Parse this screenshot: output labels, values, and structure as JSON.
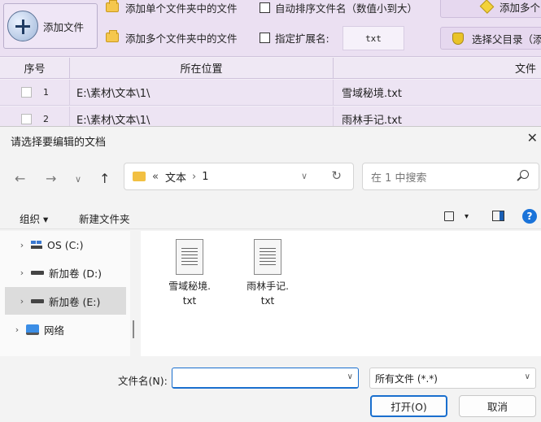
{
  "app": {
    "add_file_label": "添加文件",
    "add_single_folder_label": "添加单个文件夹中的文件",
    "add_multi_folder_label": "添加多个文件夹中的文件",
    "auto_sort_label": "自动排序文件名（数值小到大）",
    "ext_label": "指定扩展名:",
    "ext_value": "txt",
    "right_btn_1_label": "添加多个",
    "right_btn_2_label": "选择父目录（添"
  },
  "grid": {
    "headers": [
      "序号",
      "所在位置",
      "文件"
    ],
    "rows": [
      {
        "index": "1",
        "path": "E:\\素材\\文本\\1\\",
        "file": "雪域秘境.txt"
      },
      {
        "index": "2",
        "path": "E:\\素材\\文本\\1\\",
        "file": "雨林手记.txt"
      }
    ]
  },
  "dialog": {
    "title": "请选择要编辑的文档",
    "close_glyph": "✕",
    "nav": {
      "back": "←",
      "forward": "→",
      "recent": "∨",
      "up": "↑"
    },
    "breadcrumb": {
      "prefix": "«",
      "parts": [
        "文本",
        "1"
      ],
      "separator": "›",
      "dropdown": "∨",
      "refresh": "↻"
    },
    "search_placeholder": "在 1 中搜索",
    "commands": {
      "organize": "组织 ▾",
      "new_folder": "新建文件夹",
      "view_dropdown": "▾",
      "help": "?"
    },
    "tree": [
      {
        "arrow": "›",
        "label": "OS (C:)"
      },
      {
        "arrow": "›",
        "label": "新加卷 (D:)"
      },
      {
        "arrow": "›",
        "label": "新加卷 (E:)"
      },
      {
        "arrow": "›",
        "label": "网络"
      }
    ],
    "files": [
      {
        "name_line1": "雪域秘境.",
        "name_line2": "txt"
      },
      {
        "name_line1": "雨林手记.",
        "name_line2": "txt"
      }
    ],
    "filename_label": "文件名(N):",
    "filename_value": "",
    "dropdown_glyph": "∨",
    "filetype_value": "所有文件 (*.*)",
    "open_label": "打开(O)",
    "cancel_label": "取消"
  }
}
